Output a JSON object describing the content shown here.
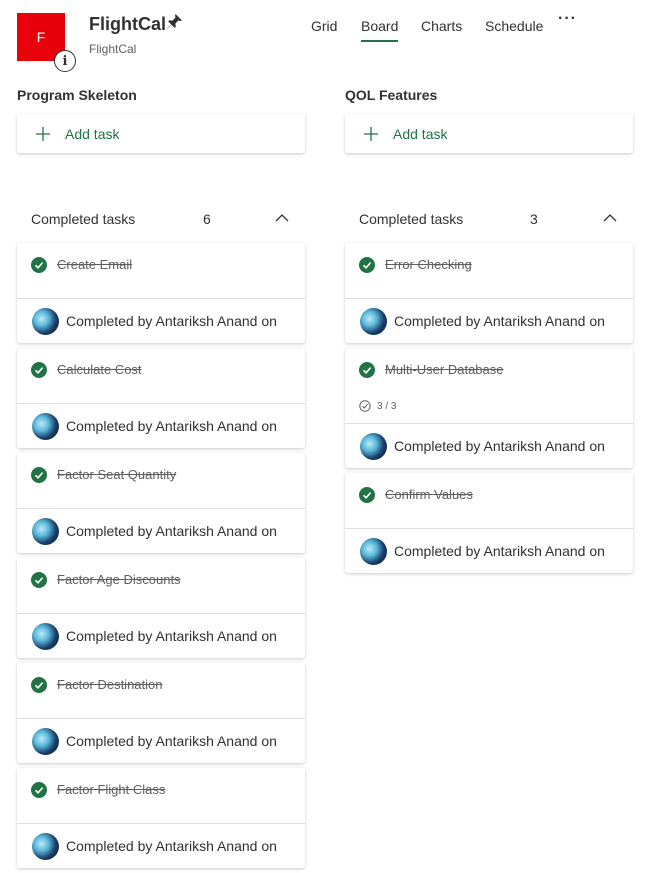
{
  "header": {
    "app_tile_letter": "F",
    "plan_title": "FlightCal",
    "plan_subtitle": "FlightCal",
    "tile_color": "#e8000b",
    "accent_color": "#217346",
    "nav_tabs": [
      {
        "label": "Grid",
        "active": false
      },
      {
        "label": "Board",
        "active": true
      },
      {
        "label": "Charts",
        "active": false
      },
      {
        "label": "Schedule",
        "active": false
      }
    ],
    "more_label": "···"
  },
  "buckets": [
    {
      "name": "Program Skeleton",
      "add_task_label": "Add task",
      "completed_label": "Completed tasks",
      "completed_count": "6",
      "tasks": [
        {
          "title": "Create Email",
          "completed_by": "Completed by Antariksh Anand on"
        },
        {
          "title": "Calculate Cost",
          "completed_by": "Completed by Antariksh Anand on"
        },
        {
          "title": "Factor Seat Quantity",
          "completed_by": "Completed by Antariksh Anand on"
        },
        {
          "title": "Factor Age Discounts",
          "completed_by": "Completed by Antariksh Anand on"
        },
        {
          "title": "Factor Destination",
          "completed_by": "Completed by Antariksh Anand on"
        },
        {
          "title": "Factor Flight Class",
          "completed_by": "Completed by Antariksh Anand on"
        }
      ]
    },
    {
      "name": "QOL Features",
      "add_task_label": "Add task",
      "completed_label": "Completed tasks",
      "completed_count": "3",
      "tasks": [
        {
          "title": "Error Checking",
          "completed_by": "Completed by Antariksh Anand on"
        },
        {
          "title": "Multi-User Database",
          "checklist": "3 / 3",
          "completed_by": "Completed by Antariksh Anand on"
        },
        {
          "title": "Confirm Values",
          "completed_by": "Completed by Antariksh Anand on"
        }
      ]
    }
  ]
}
